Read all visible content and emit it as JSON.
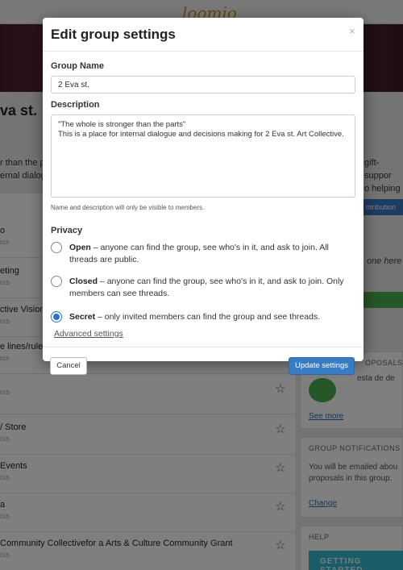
{
  "background": {
    "logo": "loomio",
    "group_title": "va st.",
    "group_desc_lines": [
      "r than the p",
      "ernal dialog"
    ],
    "right_desc_lines": [
      "gift-suppor",
      "o helping g"
    ],
    "contribution_label": "ntribution",
    "anyone_text": "one here",
    "threads": [
      {
        "title": "o",
        "date": "015",
        "star": false
      },
      {
        "title": "eting",
        "date": "015",
        "star": false
      },
      {
        "title": "ctive Vision",
        "date": "015",
        "star": false
      },
      {
        "title": "e lines/rules",
        "date": "015",
        "star": false
      },
      {
        "title": "",
        "date": "015",
        "star": true
      },
      {
        "title": "/ Store",
        "date": "015",
        "star": true
      },
      {
        "title": "Events",
        "date": "015",
        "star": true
      },
      {
        "title": "a",
        "date": "015",
        "star": true
      },
      {
        "title": "Community Collectivefor a Arts & Culture Community Grant",
        "date": "015",
        "star": true
      }
    ],
    "proposals_card": {
      "heading": "OPOSALS",
      "snippet": "esta de de",
      "link": "See more"
    },
    "notifications_card": {
      "heading": "GROUP NOTIFICATIONS",
      "lines": [
        "You will be emailed abou",
        "proposals in this group."
      ],
      "link": "Change"
    },
    "help_card": {
      "heading": "HELP",
      "banner": "GETTING STARTED"
    }
  },
  "modal": {
    "title": "Edit group settings",
    "close_glyph": "×",
    "group_name_label": "Group Name",
    "group_name_value": "2 Eva st.",
    "description_label": "Description",
    "description_value": "\"The whole is stronger than the parts\"\nThis is a place for internal dialogue and decisions making for 2 Eva st. Art Collective.",
    "hint": "Name and description will only be visible to members.",
    "privacy_label": "Privacy",
    "privacy_options": [
      {
        "name": "Open",
        "text": " – anyone can find the group, see who's in it, and ask to join. All threads are public.",
        "checked": false
      },
      {
        "name": "Closed",
        "text": " – anyone can find the group, see who's in it, and ask to join. Only members can see threads.",
        "checked": false
      },
      {
        "name": "Secret",
        "text": " – only invited members can find the group and see threads.",
        "checked": true
      }
    ],
    "advanced_link": "Advanced settings",
    "cancel_label": "Cancel",
    "update_label": "Update settings"
  },
  "colors": {
    "primary": "#3a7cc4",
    "overlay": "rgba(0,0,0,0.5)",
    "logo": "#d38a1e",
    "green": "#4caf50",
    "help_banner": "#35b9d1"
  }
}
